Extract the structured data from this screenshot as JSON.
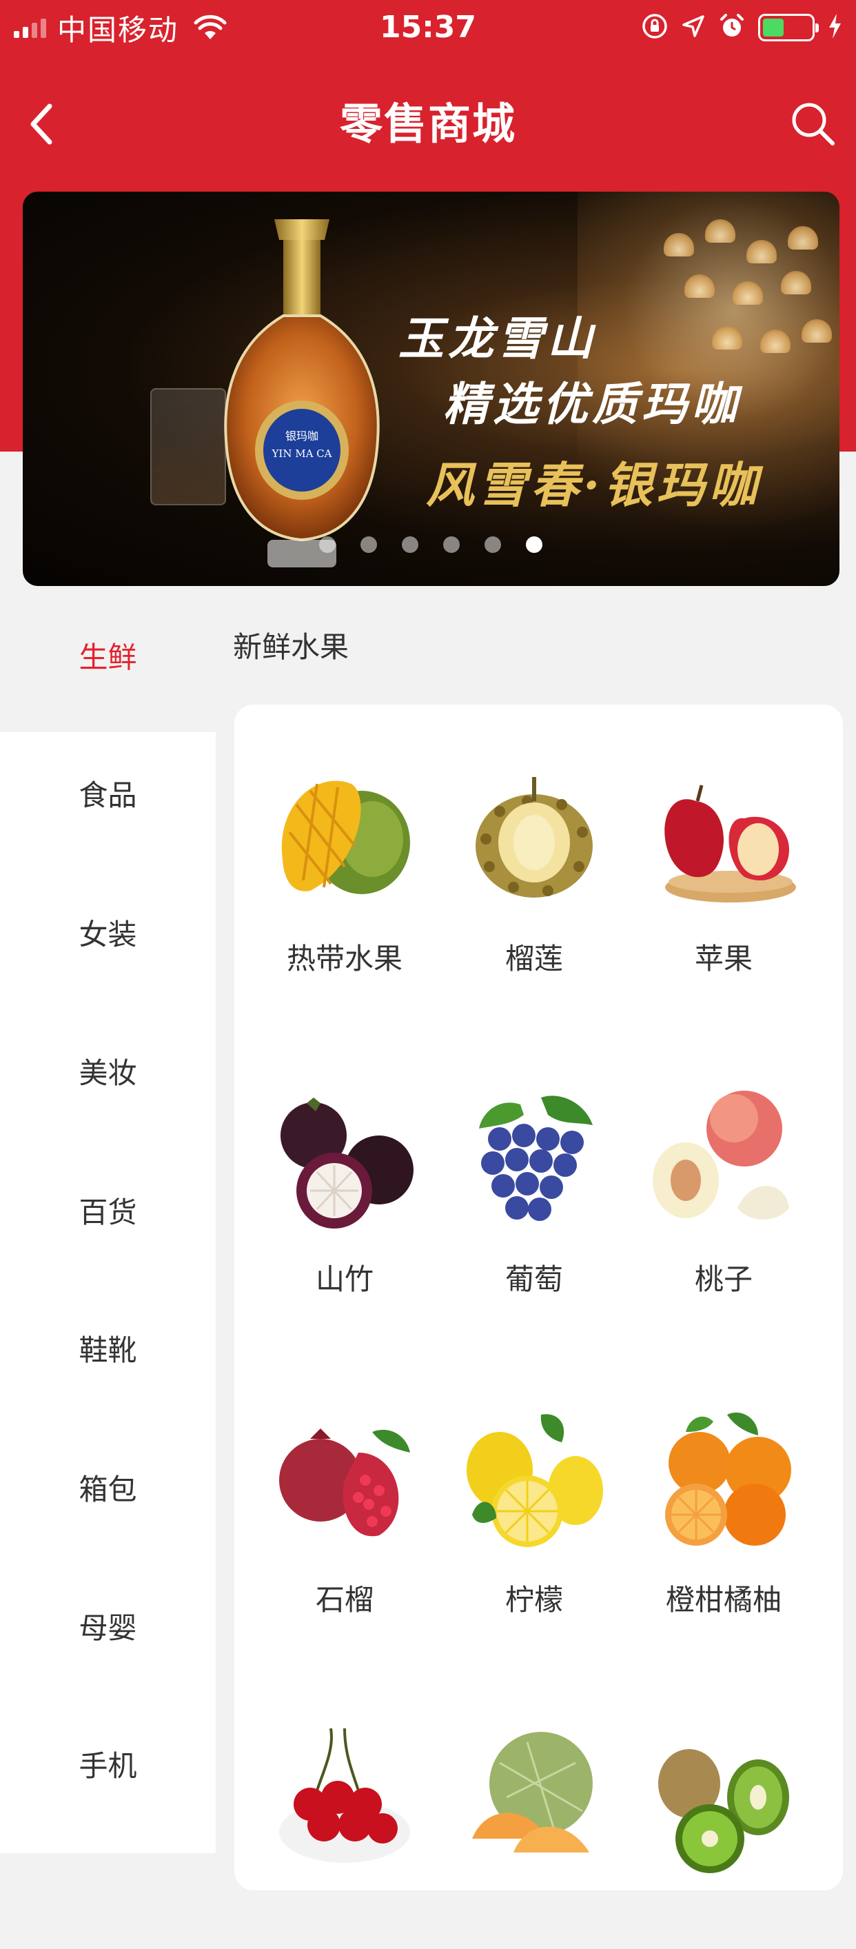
{
  "status_bar": {
    "carrier": "中国移动",
    "time": "15:37"
  },
  "nav": {
    "title": "零售商城"
  },
  "banner": {
    "line1": "玉龙雪山",
    "line2": "精选优质玛咖",
    "line3": "风雪春·银玛咖",
    "bottle_label": "YIN MA CA",
    "bottle_brand": "银玛咖",
    "slide_count": 6,
    "active_slide": 6
  },
  "sidebar": {
    "items": [
      {
        "label": "生鲜",
        "active": true
      },
      {
        "label": "食品",
        "active": false
      },
      {
        "label": "女装",
        "active": false
      },
      {
        "label": "美妆",
        "active": false
      },
      {
        "label": "百货",
        "active": false
      },
      {
        "label": "鞋靴",
        "active": false
      },
      {
        "label": "箱包",
        "active": false
      },
      {
        "label": "母婴",
        "active": false
      },
      {
        "label": "手机",
        "active": false
      }
    ]
  },
  "section": {
    "title": "新鲜水果"
  },
  "products": [
    {
      "label": "热带水果",
      "icon": "mango-icon"
    },
    {
      "label": "榴莲",
      "icon": "durian-icon"
    },
    {
      "label": "苹果",
      "icon": "apple-icon"
    },
    {
      "label": "山竹",
      "icon": "mangosteen-icon"
    },
    {
      "label": "葡萄",
      "icon": "grape-icon"
    },
    {
      "label": "桃子",
      "icon": "peach-icon"
    },
    {
      "label": "石榴",
      "icon": "pomegranate-icon"
    },
    {
      "label": "柠檬",
      "icon": "lemon-icon"
    },
    {
      "label": "橙柑橘柚",
      "icon": "orange-icon"
    },
    {
      "label": "",
      "icon": "cherry-icon"
    },
    {
      "label": "",
      "icon": "melon-icon"
    },
    {
      "label": "",
      "icon": "kiwi-icon"
    }
  ],
  "colors": {
    "brand_red": "#d8222d",
    "active_text": "#e4222e"
  }
}
